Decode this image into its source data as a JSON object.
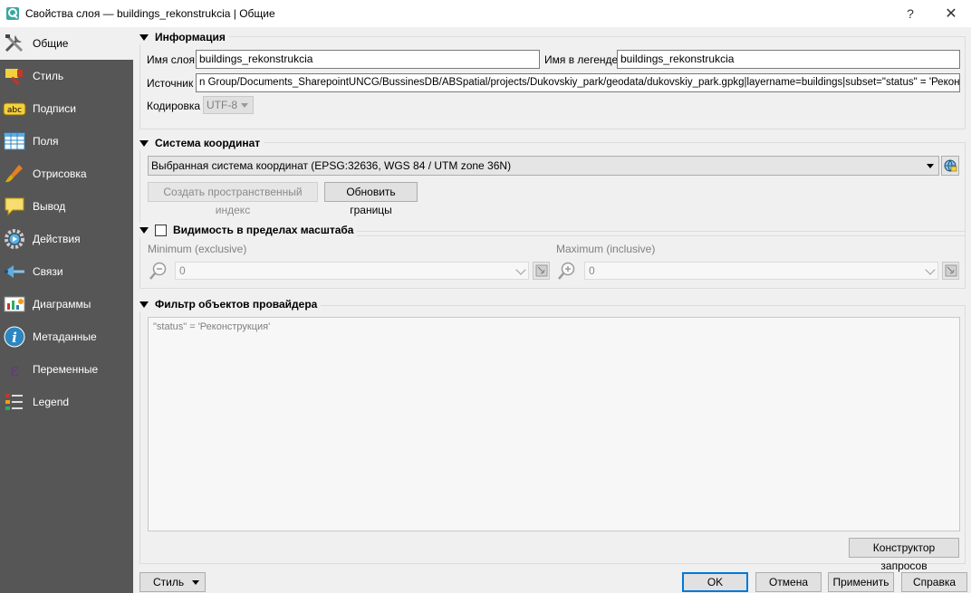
{
  "window": {
    "title": "Свойства слоя — buildings_rekonstrukcia | Общие",
    "help_glyph": "?",
    "close_glyph": "✕"
  },
  "sidebar": {
    "items": [
      {
        "label": "Общие",
        "icon": "tools-icon"
      },
      {
        "label": "Стиль",
        "icon": "paint-icon"
      },
      {
        "label": "Подписи",
        "icon": "abc-label-icon"
      },
      {
        "label": "Поля",
        "icon": "table-icon"
      },
      {
        "label": "Отрисовка",
        "icon": "brush-icon"
      },
      {
        "label": "Вывод",
        "icon": "speech-bubble-icon"
      },
      {
        "label": "Действия",
        "icon": "gear-icon"
      },
      {
        "label": "Связи",
        "icon": "relations-icon"
      },
      {
        "label": "Диаграммы",
        "icon": "diagram-icon"
      },
      {
        "label": "Метаданные",
        "icon": "info-icon"
      },
      {
        "label": "Переменные",
        "icon": "epsilon-icon"
      },
      {
        "label": "Legend",
        "icon": "legend-icon"
      }
    ]
  },
  "info": {
    "title": "Информация",
    "layer_name_label": "Имя слоя",
    "layer_name_value": "buildings_rekonstrukcia",
    "legend_name_label": "Имя в легенде",
    "legend_name_value": "buildings_rekonstrukcia",
    "source_label": "Источник",
    "source_value": "n Group/Documents_SharepointUNCG/BussinesDB/ABSpatial/projects/Dukovskiy_park/geodata/dukovskiy_park.gpkg|layername=buildings|subset=\"status\" = 'Реконструкция'",
    "encoding_label": "Кодировка",
    "encoding_value": "UTF-8"
  },
  "crs": {
    "title": "Система координат",
    "selected": "Выбранная система координат (EPSG:32636, WGS 84 / UTM zone 36N)",
    "spatial_index_label": "Создать пространственный индекс",
    "update_extents_label": "Обновить границы"
  },
  "scale": {
    "title": "Видимость в пределах масштаба",
    "min_label": "Minimum (exclusive)",
    "max_label": "Maximum (inclusive)",
    "min_value": "0",
    "max_value": "0"
  },
  "filter": {
    "title": "Фильтр объектов провайдера",
    "expression": "\"status\" = 'Реконструкция'",
    "query_builder_label": "Конструктор запросов"
  },
  "footer": {
    "style_label": "Стиль",
    "ok_label": "OK",
    "cancel_label": "Отмена",
    "apply_label": "Применить",
    "help_label": "Справка"
  },
  "colors": {
    "sidebar_bg": "#565656",
    "accent": "#0078d7"
  }
}
